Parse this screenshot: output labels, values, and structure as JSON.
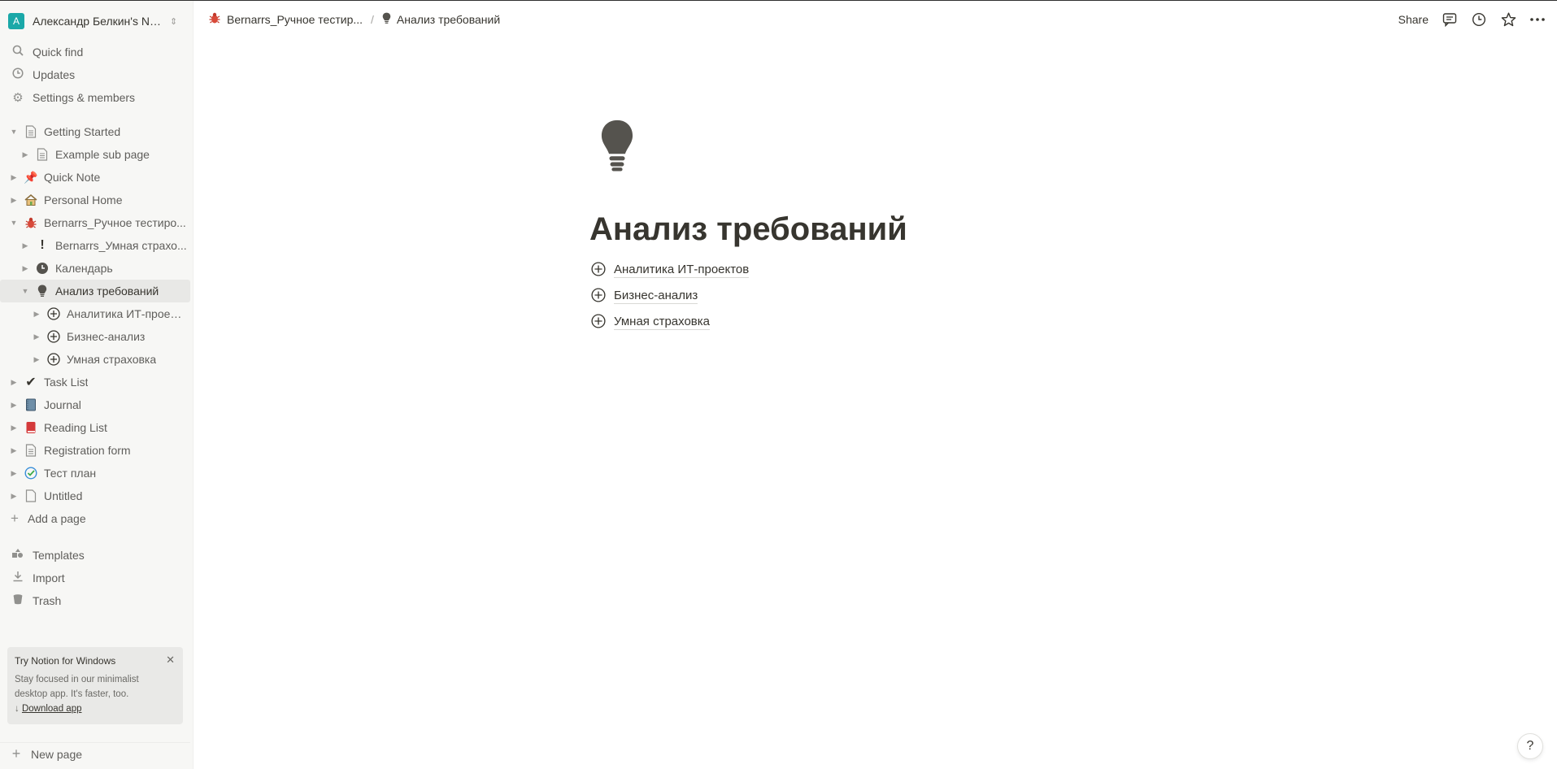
{
  "workspace": {
    "avatar_letter": "A",
    "name": "Александр Белкин's Not..."
  },
  "nav": {
    "quick_find": "Quick find",
    "updates": "Updates",
    "settings": "Settings & members"
  },
  "tree": [
    {
      "label": "Getting Started",
      "icon": "page-icon",
      "expanded": true
    },
    {
      "label": "Example sub page",
      "icon": "page-icon"
    },
    {
      "label": "Quick Note",
      "icon": "pin-icon"
    },
    {
      "label": "Personal Home",
      "icon": "house-icon"
    },
    {
      "label": "Bernarrs_Ручное тестиро...",
      "icon": "bug-icon",
      "expanded": true
    },
    {
      "label": "Bernarrs_Умная страхо...",
      "icon": "exclamation-icon"
    },
    {
      "label": "Календарь",
      "icon": "clock-icon"
    },
    {
      "label": "Анализ требований",
      "icon": "lightbulb-icon",
      "selected": true,
      "expanded": true
    },
    {
      "label": "Аналитика ИТ-проек...",
      "icon": "add-circle-icon"
    },
    {
      "label": "Бизнес-анализ",
      "icon": "add-circle-icon"
    },
    {
      "label": "Умная страховка",
      "icon": "add-circle-icon"
    },
    {
      "label": "Task List",
      "icon": "checkmark-icon"
    },
    {
      "label": "Journal",
      "icon": "notebook-icon"
    },
    {
      "label": "Reading List",
      "icon": "book-icon"
    },
    {
      "label": "Registration form",
      "icon": "page-icon"
    },
    {
      "label": "Тест план",
      "icon": "check-circle-icon"
    },
    {
      "label": "Untitled",
      "icon": "page-icon"
    }
  ],
  "add_page": "Add a page",
  "bottom_nav": {
    "templates": "Templates",
    "import": "Import",
    "trash": "Trash"
  },
  "promo": {
    "title": "Try Notion for Windows",
    "body_line1": "Stay focused in our minimalist",
    "body_line2": "desktop app. It's faster, too.",
    "link": "Download app"
  },
  "new_page": "New page",
  "breadcrumb": {
    "parent": "Bernarrs_Ручное тестир...",
    "sep": "/",
    "current": "Анализ требований"
  },
  "topbar": {
    "share": "Share"
  },
  "page": {
    "title": "Анализ требований",
    "subpages": [
      "Аналитика ИТ-проектов",
      "Бизнес-анализ",
      "Умная страховка"
    ]
  },
  "help": "?",
  "colors": {
    "sidebar_bg": "#f7f7f5",
    "text": "#37352f",
    "muted": "#5f5e5b",
    "selected_bg": "#e8e8e6",
    "avatar": "#1aa8a8"
  }
}
